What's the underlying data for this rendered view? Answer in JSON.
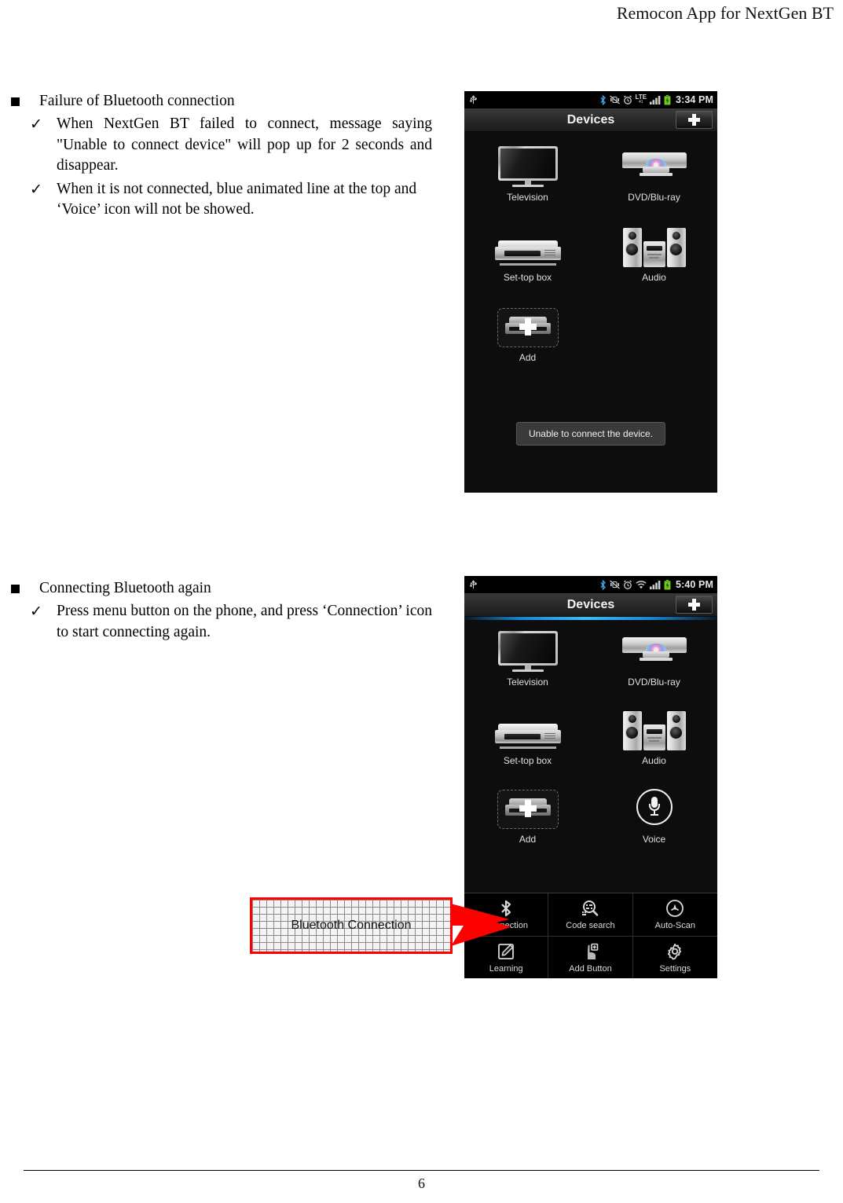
{
  "document": {
    "header_title": "Remocon App for NextGen BT",
    "page_number": "6"
  },
  "sections": [
    {
      "bullet": "Failure of Bluetooth connection",
      "checks": [
        "When NextGen BT failed to connect, message saying \"Unable to connect device\" will pop up for 2 seconds and disappear.",
        "When it is not connected, blue animated line at the top and ‘Voice’ icon will not be showed."
      ]
    },
    {
      "bullet": "Connecting Bluetooth again",
      "checks": [
        "Press menu button on the phone, and press ‘Connection’ icon to start connecting again."
      ]
    }
  ],
  "phone_one": {
    "statusbar": {
      "usb_icon": "usb-icon",
      "bluetooth_icon": "bluetooth-icon",
      "vibrate_icon": "vibrate-mute-icon",
      "alarm_icon": "alarm-clock-icon",
      "network_label": "LTE",
      "network_sub": "41",
      "signal_icon": "signal-bars-icon",
      "battery_icon": "battery-charging-icon",
      "time": "3:34 PM"
    },
    "actionbar": {
      "title": "Devices",
      "add_button": "add-plus-button"
    },
    "blue_line_visible": false,
    "devices": [
      {
        "label": "Television",
        "icon": "television-icon"
      },
      {
        "label": "DVD/Blu-ray",
        "icon": "dvd-bluray-icon"
      },
      {
        "label": "Set-top box",
        "icon": "set-top-box-icon"
      },
      {
        "label": "Audio",
        "icon": "audio-system-icon"
      },
      {
        "label": "Add",
        "icon": "add-device-icon"
      }
    ],
    "toast": "Unable to connect the device.",
    "menu_visible": false
  },
  "phone_two": {
    "statusbar": {
      "usb_icon": "usb-icon",
      "bluetooth_icon": "bluetooth-icon",
      "vibrate_icon": "vibrate-mute-icon",
      "alarm_icon": "alarm-clock-icon",
      "network_label": "wifi-icon",
      "signal_icon": "signal-bars-icon",
      "battery_icon": "battery-charging-icon",
      "time": "5:40 PM"
    },
    "actionbar": {
      "title": "Devices",
      "add_button": "add-plus-button"
    },
    "blue_line_visible": true,
    "devices": [
      {
        "label": "Television",
        "icon": "television-icon"
      },
      {
        "label": "DVD/Blu-ray",
        "icon": "dvd-bluray-icon"
      },
      {
        "label": "Set-top box",
        "icon": "set-top-box-icon"
      },
      {
        "label": "Audio",
        "icon": "audio-system-icon"
      },
      {
        "label": "Add",
        "icon": "add-device-icon"
      },
      {
        "label": "Voice",
        "icon": "microphone-icon"
      }
    ],
    "menu": [
      {
        "label": "Connection",
        "icon": "bluetooth-icon"
      },
      {
        "label": "Code search",
        "icon": "code-search-icon"
      },
      {
        "label": "Auto-Scan",
        "icon": "auto-scan-icon"
      },
      {
        "label": "Learning",
        "icon": "learning-pencil-icon"
      },
      {
        "label": "Add Button",
        "icon": "add-button-icon"
      },
      {
        "label": "Settings",
        "icon": "gear-icon"
      }
    ]
  },
  "annotation": {
    "label": "Bluetooth Connection",
    "border_color": "#ff0000"
  }
}
